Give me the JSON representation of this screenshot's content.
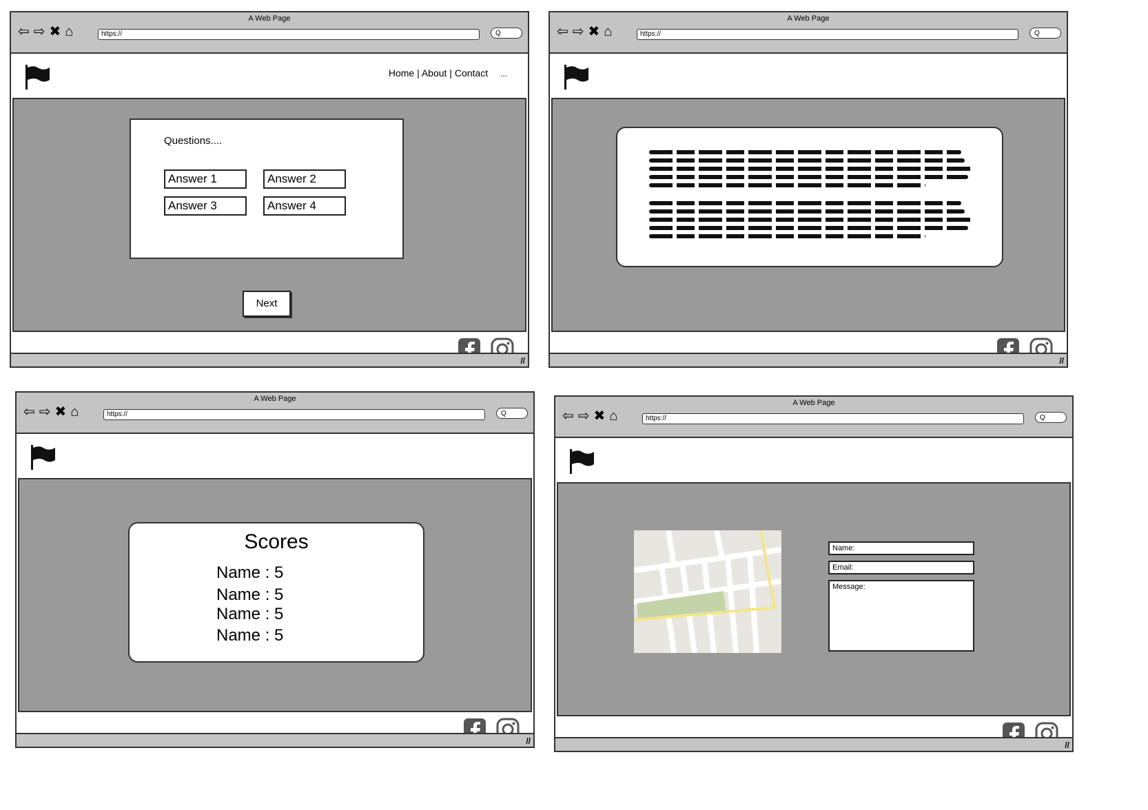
{
  "windows": {
    "title": "A Web Page",
    "url": "https://",
    "search_placeholder": "Q"
  },
  "header": {
    "nav_links": "Home | About | Contact",
    "nav_more": "..."
  },
  "quiz": {
    "question": "Questions....",
    "answers": [
      "Answer 1",
      "Answer 2",
      "Answer 3",
      "Answer 4"
    ],
    "next_label": "Next"
  },
  "scores": {
    "title": "Scores",
    "rows": [
      "Name : 5",
      "Name : 5",
      "Name : 5",
      "Name : 5"
    ]
  },
  "contact": {
    "name_label": "Name:",
    "email_label": "Email:",
    "message_label": "Message:"
  },
  "icons": {
    "back": "arrow-left-icon",
    "forward": "arrow-right-icon",
    "stop": "close-icon",
    "home": "home-icon",
    "facebook": "facebook-icon",
    "instagram": "instagram-icon",
    "flag": "flag-icon"
  },
  "colors": {
    "main_bg": "#9a9a9a",
    "chrome_bg": "#c4c4c4",
    "map_road": "#f3e58a",
    "map_park": "#c4d4a8"
  }
}
